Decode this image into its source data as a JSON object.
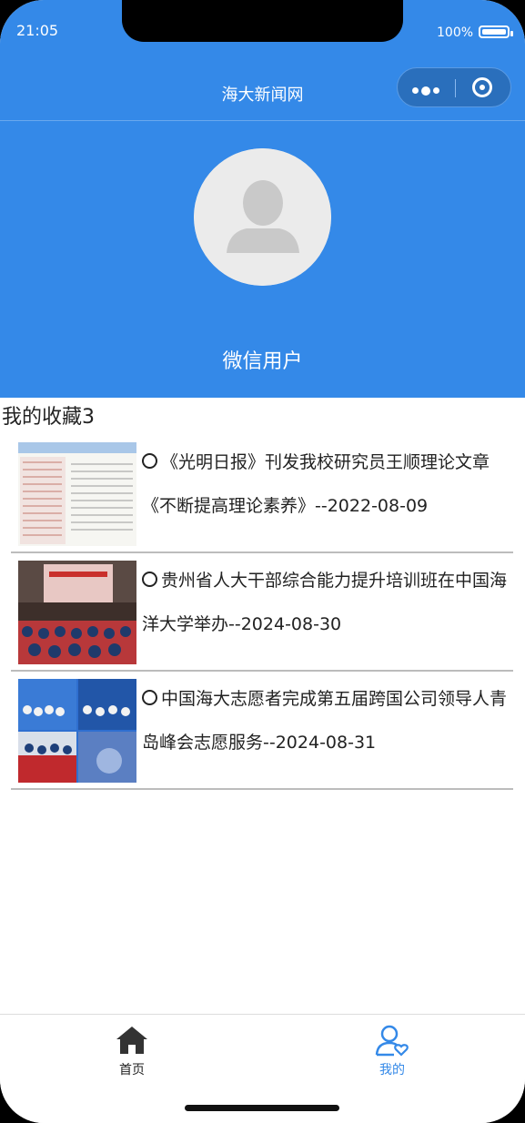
{
  "status": {
    "time": "21:05",
    "battery": "100%"
  },
  "navbar": {
    "title": "海大新闻网"
  },
  "profile": {
    "username": "微信用户"
  },
  "favorites": {
    "title": "我的收藏3",
    "items": [
      {
        "title": "《光明日报》刊发我校研究员王顺理论文章《不断提高理论素养》--2022-08-09"
      },
      {
        "title": "贵州省人大干部综合能力提升培训班在中国海洋大学举办--2024-08-30"
      },
      {
        "title": "中国海大志愿者完成第五届跨国公司领导人青岛峰会志愿服务--2024-08-31"
      }
    ]
  },
  "tabbar": {
    "home_label": "首页",
    "mine_label": "我的",
    "active_color": "#3489e8"
  }
}
